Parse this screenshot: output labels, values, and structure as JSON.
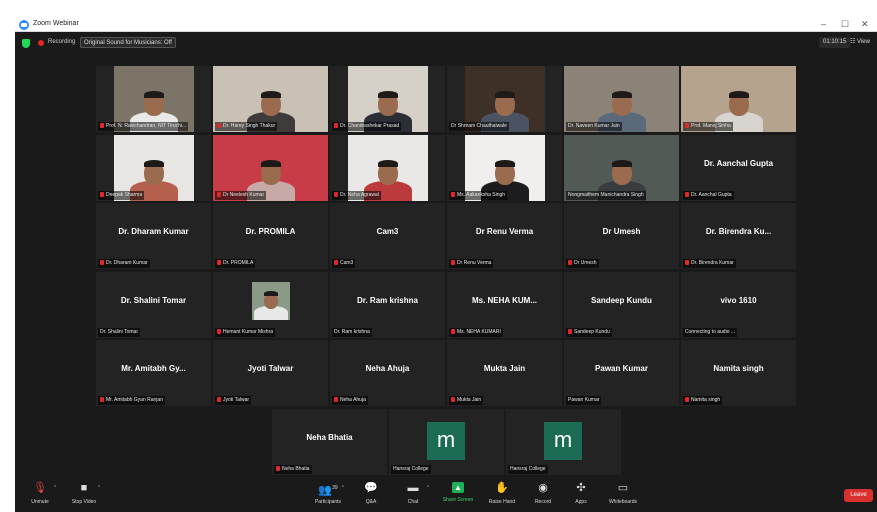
{
  "window": {
    "title": "Zoom Webinar",
    "controls": [
      "–",
      "☐",
      "✕"
    ]
  },
  "meeting_bar": {
    "recording_label": "Recording",
    "original_sound": "Original Sound for Musicians: Off",
    "timer": "01:10:15",
    "view_label": "View"
  },
  "tiles": [
    {
      "label": "Prof. N. Ravichandran, NIT Tiruchi...",
      "muted": true,
      "type": "video",
      "bg": "#7d7468",
      "shirt": "#e9e9ea"
    },
    {
      "label": "Dr. Harey Singh Thakur",
      "muted": true,
      "type": "video",
      "bg": "#c9c1b6",
      "shirt": "#3f3b3a"
    },
    {
      "label": "Dr. Chandrashekar Prasad",
      "muted": true,
      "type": "video",
      "bg": "#d5d0c8",
      "shirt": "#2c2e35"
    },
    {
      "label": "Dr Shriram Chauthaiwale",
      "muted": false,
      "type": "video",
      "bg": "#3e2f27",
      "shirt": "#4b5363"
    },
    {
      "label": "Dr. Naveen Kumar Jain",
      "muted": false,
      "type": "video",
      "bg": "#8c8378",
      "shirt": "#5b6a7a",
      "active": true
    },
    {
      "label": "Prof. Manoj Sinha",
      "muted": true,
      "type": "video",
      "bg": "#b5a38d",
      "shirt": "#d8d4cf"
    },
    {
      "label": "Deepak Sharma",
      "muted": true,
      "type": "video",
      "bg": "#e8e6e3",
      "shirt": "#b4604c"
    },
    {
      "label": "Dr Neelesh Kumar",
      "muted": true,
      "type": "video",
      "bg": "#c73c46",
      "shirt": "#c7aaa7"
    },
    {
      "label": "Dr. Neha Agrawal",
      "muted": true,
      "type": "video",
      "bg": "#e9e8e6",
      "shirt": "#bb3b3c"
    },
    {
      "label": "Ms. Aakanksha Singh",
      "muted": true,
      "type": "video",
      "bg": "#f0efed",
      "shirt": "#1c1b1d"
    },
    {
      "label": "Nongmaithem Manichandra Singh",
      "muted": false,
      "type": "video",
      "bg": "#515a55",
      "shirt": "#3a3d3f"
    },
    {
      "label": "Dr. Aanchal Gupta",
      "muted": true,
      "type": "name",
      "name": "Dr. Aanchal Gupta"
    },
    {
      "label": "Dr. Dharam Kumar",
      "muted": true,
      "type": "name",
      "name": "Dr. Dharam Kumar"
    },
    {
      "label": "Dr. PROMILA",
      "muted": true,
      "type": "name",
      "name": "Dr. PROMILA"
    },
    {
      "label": "Cam3",
      "muted": true,
      "type": "name",
      "name": "Cam3"
    },
    {
      "label": "Dr Renu Verma",
      "muted": true,
      "type": "name",
      "name": "Dr Renu Verma"
    },
    {
      "label": "Dr Umesh",
      "muted": true,
      "type": "name",
      "name": "Dr Umesh"
    },
    {
      "label": "Dr. Birendra Kumar",
      "muted": true,
      "type": "name",
      "name": "Dr. Birendra Ku..."
    },
    {
      "label": "Dr. Shalini Tomar",
      "muted": false,
      "type": "name",
      "name": "Dr. Shalini Tomar"
    },
    {
      "label": "Hemant Kumar Mishra",
      "muted": true,
      "type": "photo",
      "bg": "#8a9a86",
      "shirt": "#e8e8e8"
    },
    {
      "label": "Dr. Ram krishna",
      "muted": false,
      "type": "name",
      "name": "Dr. Ram krishna"
    },
    {
      "label": "Ms. NEHA KUMARI",
      "muted": true,
      "type": "name",
      "name": "Ms. NEHA KUM..."
    },
    {
      "label": "Sandeep Kundu",
      "muted": true,
      "type": "name",
      "name": "Sandeep Kundu"
    },
    {
      "label": "Connecting to audio ...",
      "muted": false,
      "type": "name",
      "name": "vivo 1610"
    },
    {
      "label": "Mr. Amitabh Gyan Ranjan",
      "muted": true,
      "type": "name",
      "name": "Mr. Amitabh Gy..."
    },
    {
      "label": "Jyoti Talwar",
      "muted": true,
      "type": "name",
      "name": "Jyoti Talwar"
    },
    {
      "label": "Neha Ahuja",
      "muted": true,
      "type": "name",
      "name": "Neha Ahuja"
    },
    {
      "label": "Mukta Jain",
      "muted": true,
      "type": "name",
      "name": "Mukta Jain"
    },
    {
      "label": "Pawan Kumar",
      "muted": false,
      "type": "name",
      "name": "Pawan Kumar"
    },
    {
      "label": "Namita singh",
      "muted": true,
      "type": "name",
      "name": "Namita singh"
    },
    {
      "label": "Neha Bhatia",
      "muted": true,
      "type": "name",
      "name": "Neha Bhatia"
    },
    {
      "label": "Hansraj College",
      "muted": false,
      "type": "avatar",
      "letter": "m"
    },
    {
      "label": "Hansraj College",
      "muted": false,
      "type": "avatar",
      "letter": "m"
    }
  ],
  "toolbar": {
    "unmute": "Unmute",
    "stop_video": "Stop Video",
    "participants": "Participants",
    "participants_count": "39",
    "qa": "Q&A",
    "chat": "Chat",
    "share_screen": "Share Screen",
    "raise_hand": "Raise Hand",
    "record": "Record",
    "apps": "Apps",
    "whiteboards": "Whiteboards",
    "leave": "Leave"
  },
  "colors": {
    "active_speaker": "#b8d63a",
    "leave": "#d9302f",
    "share": "#1fb15a",
    "avatar": "#1b6b55"
  }
}
